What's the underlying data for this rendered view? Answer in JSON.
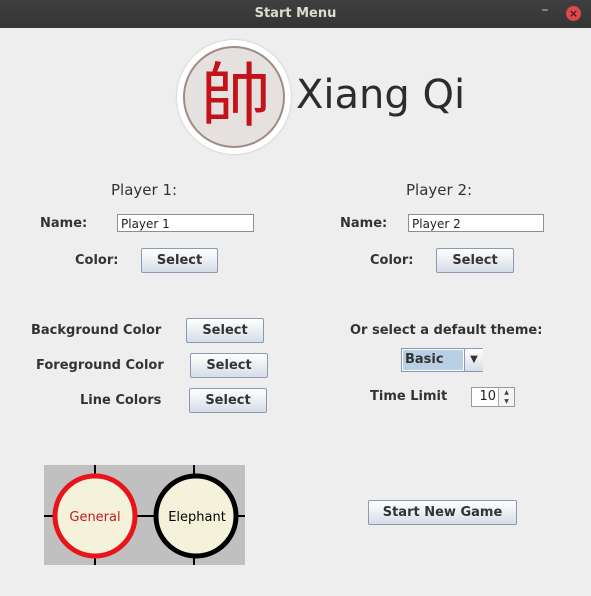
{
  "window": {
    "title": "Start Menu"
  },
  "logo": {
    "glyph": "帥",
    "title": "Xiang Qi"
  },
  "player1": {
    "heading": "Player 1:",
    "name_label": "Name:",
    "name_value": "Player 1",
    "color_label": "Color:",
    "color_button": "Select"
  },
  "player2": {
    "heading": "Player 2:",
    "name_label": "Name:",
    "name_value": "Player 2",
    "color_label": "Color:",
    "color_button": "Select"
  },
  "theme": {
    "background_label": "Background Color",
    "background_button": "Select",
    "foreground_label": "Foreground Color",
    "foreground_button": "Select",
    "line_label": "Line Colors",
    "line_button": "Select",
    "default_label": "Or select a default theme:",
    "default_value": "Basic"
  },
  "time": {
    "label": "Time Limit",
    "value": "10"
  },
  "preview": {
    "piece1": "General",
    "piece2": "Elephant",
    "piece1_color": "#e8141a",
    "piece2_color": "#000000",
    "piece_fill": "#f5f2dc",
    "board_color": "#c0c0c0"
  },
  "actions": {
    "start_button": "Start New Game"
  },
  "icons": {
    "minimize": "minimize-icon",
    "close": "close-icon",
    "dropdown": "chevron-down-icon"
  }
}
